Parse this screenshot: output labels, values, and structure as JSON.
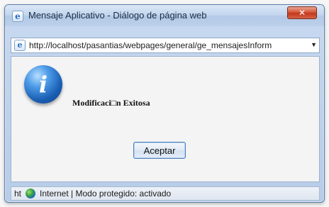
{
  "window": {
    "title": "Mensaje Aplicativo - Diálogo de página web",
    "close_label": "✕",
    "title_icon": "ie-page-icon"
  },
  "address": {
    "url": "http://localhost/pasantias/webpages/general/ge_mensajesInform",
    "page_icon": "ie-page-icon",
    "dropdown_icon": "chevron-down-icon"
  },
  "content": {
    "icon": "info-icon",
    "message": "Modificaci□n Exitosa",
    "accept_label": "Aceptar"
  },
  "status": {
    "left": "ht",
    "zone_icon": "globe-icon",
    "text": "Internet | Modo protegido: activado"
  }
}
